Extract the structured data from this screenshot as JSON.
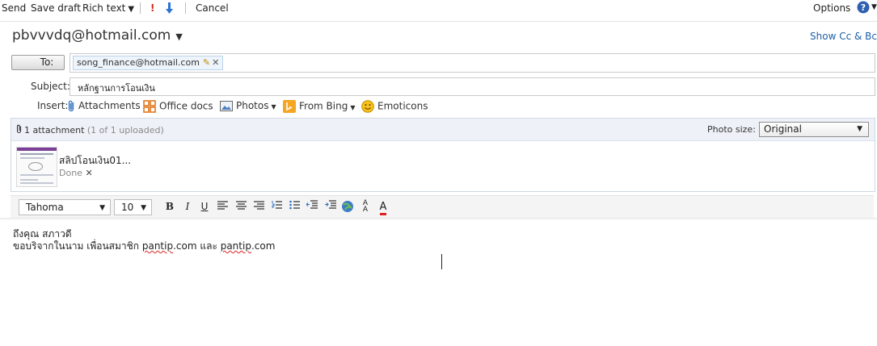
{
  "toolbar": {
    "send": "Send",
    "save_draft": "Save draft",
    "rich_text": "Rich text",
    "cancel": "Cancel",
    "options": "Options"
  },
  "from": {
    "address": "pbvvvdq@hotmail.com"
  },
  "show_cc_bcc": "Show Cc & Bcc",
  "to": {
    "label": "To:",
    "recipient": "song_finance@hotmail.com"
  },
  "subject": {
    "label": "Subject:",
    "value": "หลักฐานการโอนเงิน"
  },
  "insert": {
    "label": "Insert:",
    "attachments": "Attachments",
    "office_docs": "Office docs",
    "photos": "Photos",
    "from_bing": "From Bing",
    "emoticons": "Emoticons"
  },
  "attachment_box": {
    "count": "1 attachment",
    "status": "(1 of 1 uploaded)",
    "photo_size_label": "Photo size:",
    "photo_size_value": "Original",
    "file_name": "สลิปโอนเงิน01...",
    "file_status": "Done"
  },
  "format": {
    "font": "Tahoma",
    "size": "10"
  },
  "message": {
    "line1": "ถึงคุณ สภาวดี",
    "line2_prefix": "ขอบริจากในนาม เพื่อนสมาชิก ",
    "link1": "pantip",
    "line2_mid1": ".com และ ",
    "link2": "pantip",
    "line2_mid2": ".com"
  },
  "colors": {
    "link_blue": "#1f5fa8",
    "attachment_header": "#eef2f8",
    "important_red": "#d8261d",
    "low_priority_blue": "#2a74d6"
  }
}
